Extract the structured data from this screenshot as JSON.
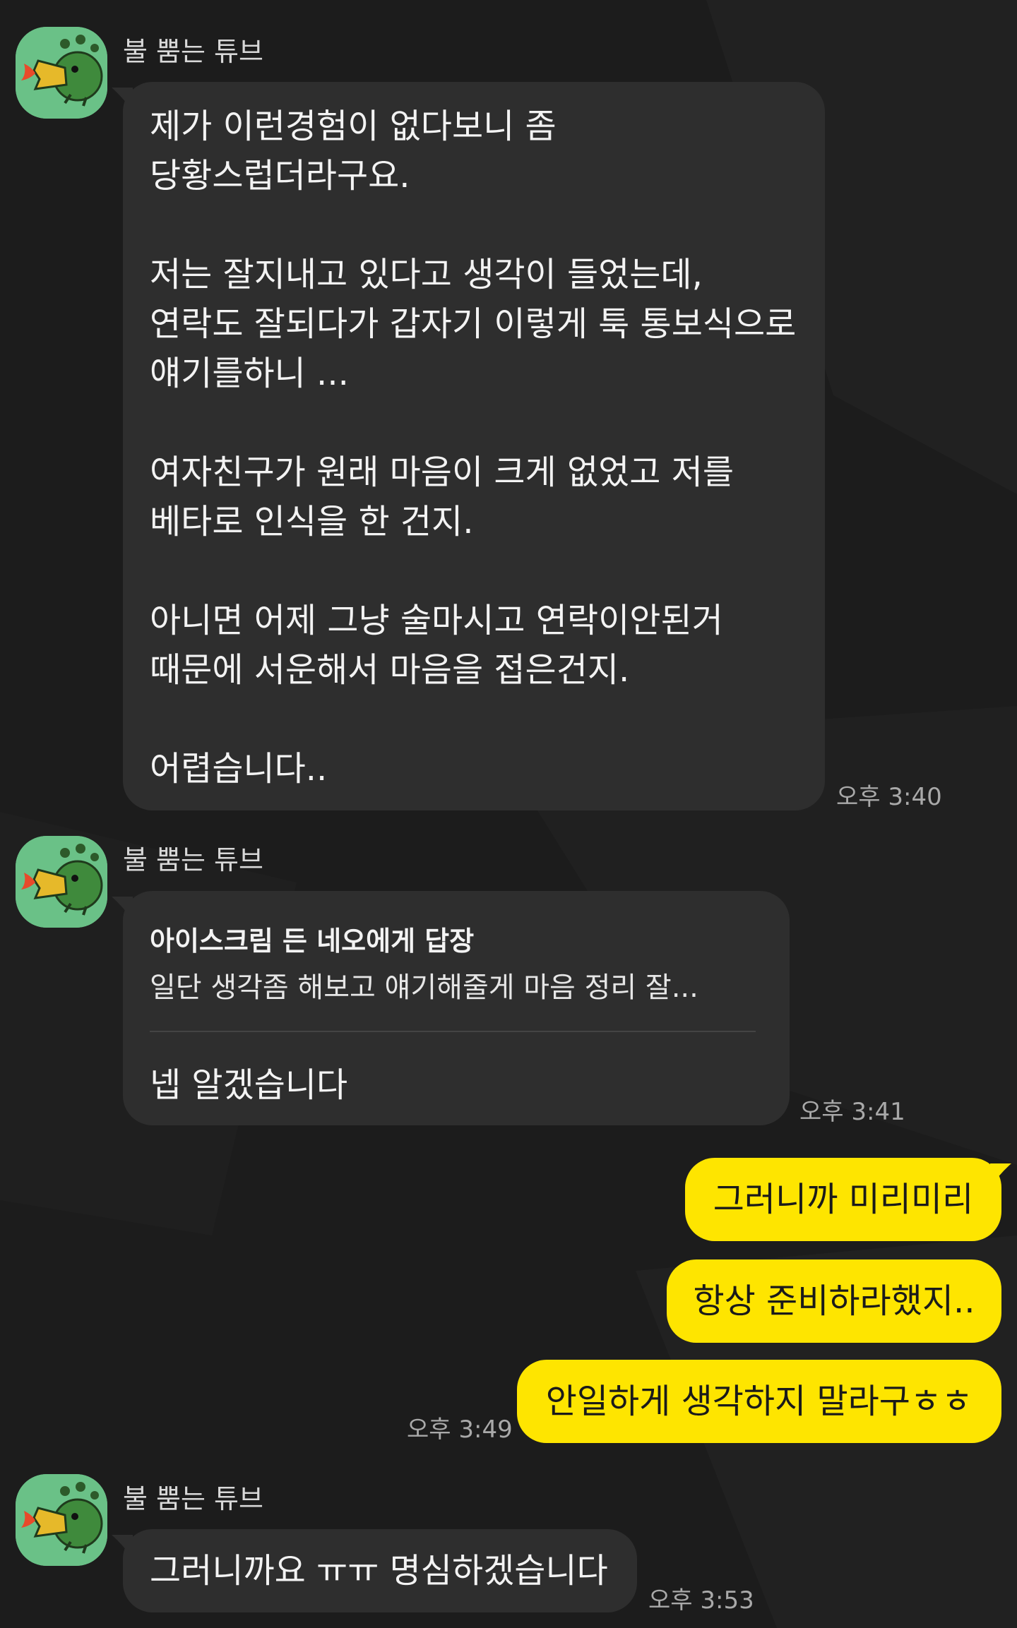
{
  "colors": {
    "background": "#1c1c1c",
    "incoming_bubble": "#2e2e2e",
    "outgoing_bubble": "#fee500",
    "avatar_bg": "#6ac187"
  },
  "messages": {
    "m1": {
      "sender": "불 뿜는 튜브",
      "avatar_icon": "fire-breathing-tube-avatar-icon",
      "text": "제가 이런경험이 없다보니 좀\n당황스럽더라구요.\n\n저는 잘지내고 있다고 생각이 들었는데,\n연락도 잘되다가 갑자기 이렇게 툭 통보식으로\n얘기를하니 ...\n\n여자친구가 원래 마음이 크게 없었고 저를\n베타로 인식을 한 건지.\n\n아니면 어제 그냥 술마시고 연락이안된거\n때문에 서운해서 마음을 접은건지.\n\n어렵습니다..",
      "time": "오후 3:40"
    },
    "m2": {
      "sender": "불 뿜는 튜브",
      "avatar_icon": "fire-breathing-tube-avatar-icon",
      "reply_title": "아이스크림 든 네오에게 답장",
      "reply_quote": "일단 생각좀 해보고 얘기해줄게 마음 정리 잘...",
      "text": "넵 알겠습니다",
      "time": "오후 3:41"
    },
    "mine": {
      "lines": [
        "그러니까 미리미리",
        "항상 준비하라했지..",
        "안일하게 생각하지 말라구ㅎㅎ"
      ],
      "time": "오후 3:49"
    },
    "m3": {
      "sender": "불 뿜는 튜브",
      "avatar_icon": "fire-breathing-tube-avatar-icon",
      "text": "그러니까요 ㅠㅠ 명심하겠습니다",
      "time": "오후 3:53"
    }
  }
}
